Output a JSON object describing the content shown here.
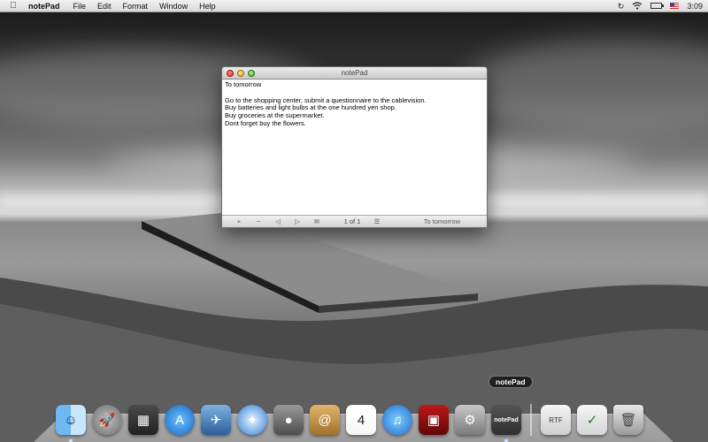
{
  "menubar": {
    "apple_icon": "apple-icon",
    "app_name": "notePad",
    "menus": [
      "File",
      "Edit",
      "Format",
      "Window",
      "Help"
    ],
    "status_icons": [
      "time-machine-icon",
      "wifi-icon",
      "battery-icon",
      "flag-icon"
    ],
    "clock": "3:09"
  },
  "window": {
    "title": "notePad",
    "lines": [
      "To tomorrow",
      "",
      "Go to the shopping center, submit a questionnaire to the cablevision.",
      "Buy batteries and light bulbs at the one hundred yen shop.",
      "Buy groceries at the supermarket.",
      "Dont forget buy the flowers."
    ],
    "bottombar": {
      "add": "+",
      "remove": "−",
      "prev": "◁",
      "next": "▷",
      "mail": "✉",
      "page_indicator": "1 of 1",
      "list": "☰",
      "note_title": "To tomorrow"
    }
  },
  "dock": {
    "tooltip": "notePad",
    "items": [
      {
        "name": "finder",
        "glyph": "☺",
        "running": true
      },
      {
        "name": "launchpad",
        "glyph": "🚀",
        "running": false
      },
      {
        "name": "mission-control",
        "glyph": "▦",
        "running": false
      },
      {
        "name": "app-store",
        "glyph": "A",
        "running": false
      },
      {
        "name": "mail",
        "glyph": "✈",
        "running": false
      },
      {
        "name": "safari",
        "glyph": "✦",
        "running": false
      },
      {
        "name": "facetime",
        "glyph": "●",
        "running": false
      },
      {
        "name": "contacts",
        "glyph": "@",
        "running": false
      },
      {
        "name": "calendar",
        "glyph": "4",
        "running": false
      },
      {
        "name": "itunes",
        "glyph": "♫",
        "running": false
      },
      {
        "name": "photo-booth",
        "glyph": "▣",
        "running": false
      },
      {
        "name": "system-preferences",
        "glyph": "⚙",
        "running": false
      },
      {
        "name": "notepad",
        "glyph": "notePad",
        "running": true
      },
      {
        "name": "documents",
        "glyph": "RTF",
        "running": false
      },
      {
        "name": "downloads",
        "glyph": "✓",
        "running": false
      },
      {
        "name": "trash",
        "glyph": "🗑",
        "running": false
      }
    ]
  }
}
